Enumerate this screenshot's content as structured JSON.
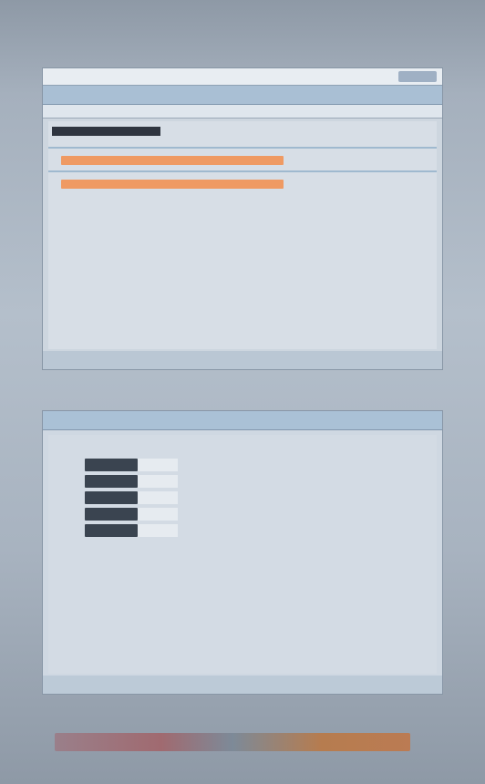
{
  "top_text": "",
  "win1": {
    "title": "",
    "titlebar_button": "",
    "toolbar": [
      "",
      "",
      ""
    ],
    "tabs": [
      "",
      "",
      ""
    ],
    "heading": "",
    "sections": [
      {
        "lines": [
          "",
          "",
          "",
          "",
          ""
        ],
        "highlight": false
      },
      {
        "lines": [
          "",
          "",
          "",
          "",
          "",
          ""
        ],
        "highlight": true
      },
      {
        "lines": [
          "",
          "",
          "",
          "",
          ""
        ],
        "highlight": true
      },
      {
        "lines": [
          "",
          ""
        ],
        "highlight": false
      }
    ],
    "status": ""
  },
  "caption2": "",
  "win2": {
    "toolbar": [
      "",
      ""
    ],
    "title": "",
    "subtitle": "",
    "label": "",
    "table": [
      {
        "k": "",
        "v": ""
      },
      {
        "k": "",
        "v": ""
      },
      {
        "k": "",
        "v": ""
      },
      {
        "k": "",
        "v": ""
      },
      {
        "k": "",
        "v": ""
      }
    ],
    "note": "",
    "status_left": "",
    "status_right": ""
  },
  "footer": ""
}
